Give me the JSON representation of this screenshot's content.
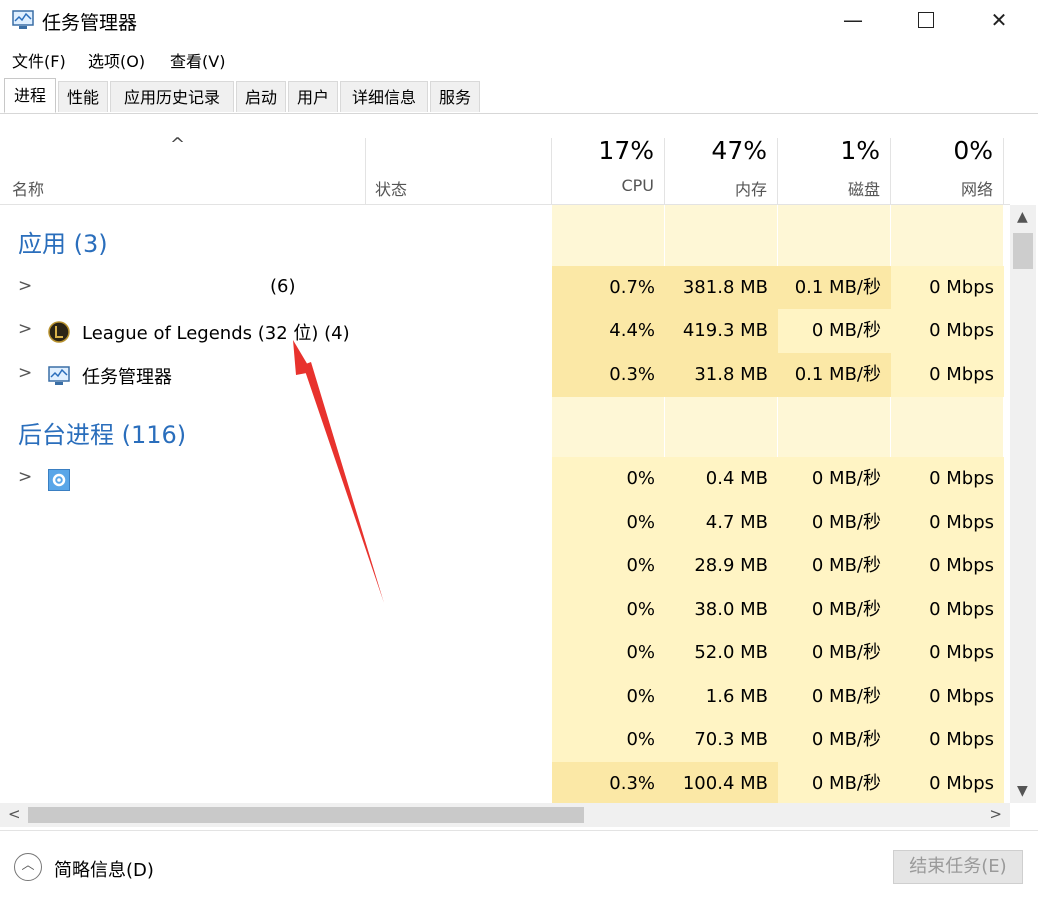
{
  "window": {
    "title": "任务管理器",
    "minimize": "—",
    "close": "✕"
  },
  "menu": [
    {
      "label": "文件(F)"
    },
    {
      "label": "选项(O)"
    },
    {
      "label": "查看(V)"
    }
  ],
  "tabs": [
    {
      "label": "进程",
      "active": true
    },
    {
      "label": "性能"
    },
    {
      "label": "应用历史记录"
    },
    {
      "label": "启动"
    },
    {
      "label": "用户"
    },
    {
      "label": "详细信息"
    },
    {
      "label": "服务"
    }
  ],
  "columns": {
    "name": "名称",
    "status": "状态",
    "cpu": {
      "pct": "17%",
      "label": "CPU"
    },
    "memory": {
      "pct": "47%",
      "label": "内存"
    },
    "disk": {
      "pct": "1%",
      "label": "磁盘"
    },
    "network": {
      "pct": "0%",
      "label": "网络"
    }
  },
  "groups": {
    "apps": "应用 (3)",
    "background": "后台进程 (116)"
  },
  "app_rows": [
    {
      "name": "(6)",
      "cpu": "0.7%",
      "mem": "381.8 MB",
      "disk": "0.1 MB/秒",
      "net": "0 Mbps",
      "icon": "blank-icon"
    },
    {
      "name": "League of Legends (32 位) (4)",
      "cpu": "4.4%",
      "mem": "419.3 MB",
      "disk": "0 MB/秒",
      "net": "0 Mbps",
      "icon": "league-icon"
    },
    {
      "name": "任务管理器",
      "cpu": "0.3%",
      "mem": "31.8 MB",
      "disk": "0.1 MB/秒",
      "net": "0 Mbps",
      "icon": "task-manager-icon"
    }
  ],
  "bg_rows": [
    {
      "cpu": "0%",
      "mem": "0.4 MB",
      "disk": "0 MB/秒",
      "net": "0 Mbps",
      "icon": "gear-icon"
    },
    {
      "cpu": "0%",
      "mem": "4.7 MB",
      "disk": "0 MB/秒",
      "net": "0 Mbps"
    },
    {
      "cpu": "0%",
      "mem": "28.9 MB",
      "disk": "0 MB/秒",
      "net": "0 Mbps"
    },
    {
      "cpu": "0%",
      "mem": "38.0 MB",
      "disk": "0 MB/秒",
      "net": "0 Mbps"
    },
    {
      "cpu": "0%",
      "mem": "52.0 MB",
      "disk": "0 MB/秒",
      "net": "0 Mbps"
    },
    {
      "cpu": "0%",
      "mem": "1.6 MB",
      "disk": "0 MB/秒",
      "net": "0 Mbps"
    },
    {
      "cpu": "0%",
      "mem": "70.3 MB",
      "disk": "0 MB/秒",
      "net": "0 Mbps"
    },
    {
      "cpu": "0.3%",
      "mem": "100.4 MB",
      "disk": "0 MB/秒",
      "net": "0 Mbps"
    }
  ],
  "footer": {
    "fewer_details": "简略信息(D)",
    "end_task": "结束任务(E)"
  },
  "colors": {
    "group_blue": "#2a6ebc",
    "cell_light": "#fff4c4",
    "cell_mid": "#fbe8a6",
    "arrow_red": "#e8322d"
  }
}
